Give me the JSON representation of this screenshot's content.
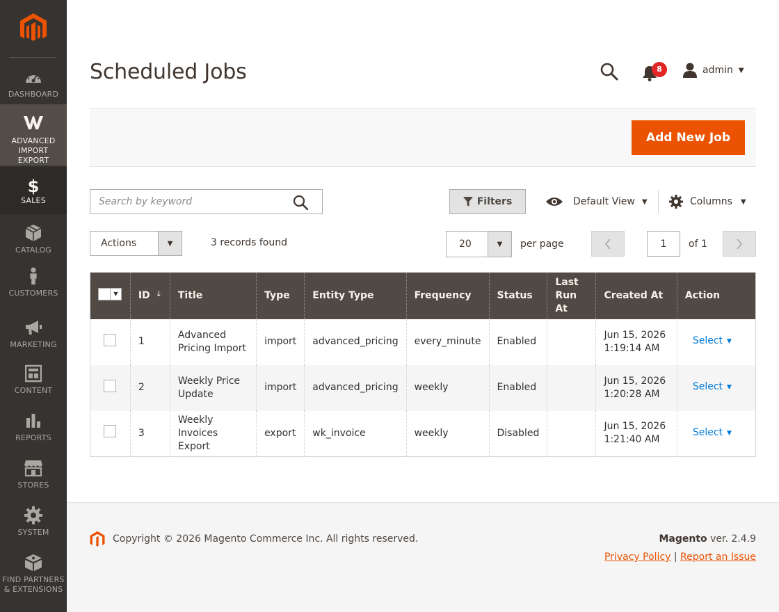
{
  "sidebar": {
    "logo": "magento-logo",
    "items": [
      {
        "label": "DASHBOARD",
        "icon": "dashboard-icon"
      },
      {
        "label": "ADVANCED\nIMPORT\nEXPORT",
        "icon": "advanced-import-export-icon"
      },
      {
        "label": "SALES",
        "icon": "dollar-icon"
      },
      {
        "label": "CATALOG",
        "icon": "catalog-box-icon"
      },
      {
        "label": "CUSTOMERS",
        "icon": "customer-person-icon"
      },
      {
        "label": "MARKETING",
        "icon": "megaphone-icon"
      },
      {
        "label": "CONTENT",
        "icon": "content-layout-icon"
      },
      {
        "label": "REPORTS",
        "icon": "bar-chart-icon"
      },
      {
        "label": "STORES",
        "icon": "store-icon"
      },
      {
        "label": "SYSTEM",
        "icon": "gear-icon"
      },
      {
        "label": "FIND PARTNERS\n& EXTENSIONS",
        "icon": "extensions-box-icon"
      }
    ]
  },
  "header": {
    "title": "Scheduled Jobs",
    "notifications_count": "8",
    "user": "admin"
  },
  "action_bar": {
    "add_button": "Add New Job"
  },
  "toolbar": {
    "search_placeholder": "Search by keyword",
    "filters": "Filters",
    "view": "Default View",
    "columns": "Columns",
    "actions": "Actions",
    "records_found": "3 records found",
    "per_page_value": "20",
    "per_page_label": "per page",
    "page_value": "1",
    "page_of": "of 1"
  },
  "grid": {
    "headers": {
      "id": "ID",
      "title": "Title",
      "type": "Type",
      "entity_type": "Entity Type",
      "frequency": "Frequency",
      "status": "Status",
      "last_run_at": "Last\nRun At",
      "created_at": "Created At",
      "action": "Action"
    },
    "rows": [
      {
        "id": "1",
        "title": "Advanced\nPricing Import",
        "type": "import",
        "entity_type": "advanced_pricing",
        "frequency": "every_minute",
        "status": "Enabled",
        "last_run_at": "",
        "created_at": "Jun 15, 2026\n1:19:14 AM",
        "action": "Select"
      },
      {
        "id": "2",
        "title": "Weekly Price\nUpdate",
        "type": "import",
        "entity_type": "advanced_pricing",
        "frequency": "weekly",
        "status": "Enabled",
        "last_run_at": "",
        "created_at": "Jun 15, 2026\n1:20:28 AM",
        "action": "Select"
      },
      {
        "id": "3",
        "title": "Weekly Invoices\nExport",
        "type": "export",
        "entity_type": "wk_invoice",
        "frequency": "weekly",
        "status": "Disabled",
        "last_run_at": "",
        "created_at": "Jun 15, 2026\n1:21:40 AM",
        "action": "Select"
      }
    ]
  },
  "footer": {
    "copyright": "Copyright © 2026 Magento Commerce Inc. All rights reserved.",
    "brand": "Magento",
    "version": " ver. 2.4.9",
    "privacy": "Privacy Policy",
    "separator": " | ",
    "report": "Report an Issue"
  },
  "colors": {
    "sidebar_bg": "#373330",
    "sidebar_active": "#524d49",
    "accent": "#eb5202",
    "grid_header": "#514943",
    "link": "#007bdb",
    "badge": "#e22626"
  }
}
